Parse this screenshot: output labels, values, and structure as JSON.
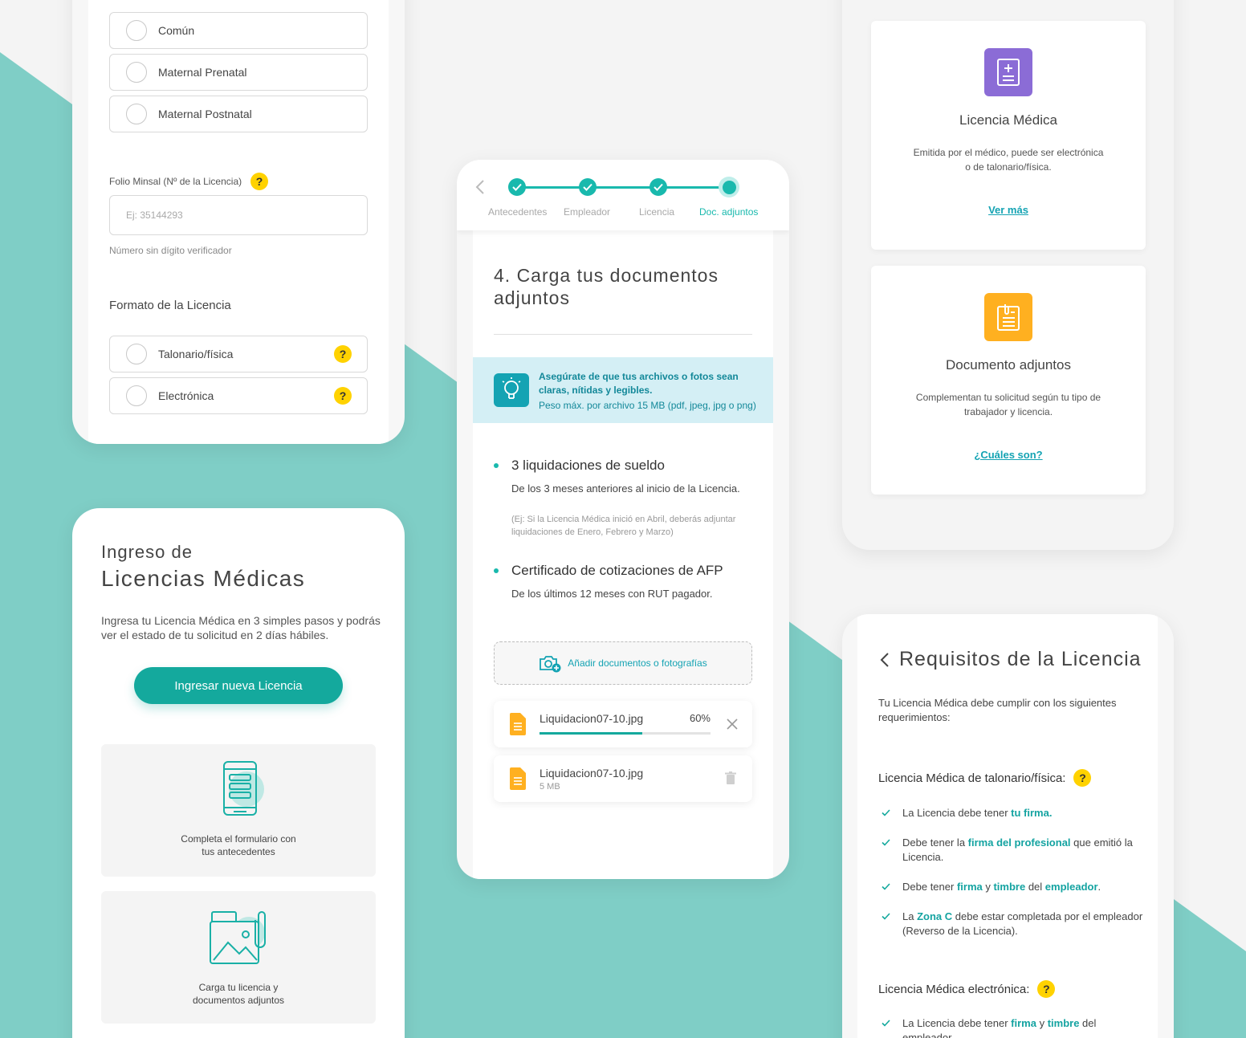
{
  "colors": {
    "teal": "#14a99d",
    "bg_teal": "#7fcec6",
    "purple": "#8b6cd6",
    "orange": "#ffb020",
    "yellow": "#ffd200"
  },
  "form": {
    "license_types": [
      "Común",
      "Maternal Prenatal",
      "Maternal Postnatal"
    ],
    "folio_label": "Folio Minsal (Nº de la Licencia)",
    "folio_placeholder": "Ej: 35144293",
    "folio_hint": "Número sin dígito verificador",
    "format_title": "Formato de la Licencia",
    "format_options": [
      "Talonario/física",
      "Electrónica"
    ],
    "help_icon": "?"
  },
  "landing": {
    "title_small": "Ingreso de",
    "title_big": "Licencias Médicas",
    "description": "Ingresa tu Licencia Médica en 3 simples pasos y podrás ver el estado de tu solicitud en 2 días hábiles.",
    "cta": "Ingresar nueva Licencia",
    "steps": [
      {
        "line1": "Completa el formulario con",
        "line2": "tus antecedentes",
        "icon": "form-phone-icon"
      },
      {
        "line1": "Carga tu licencia y",
        "line2": "documentos adjuntos",
        "icon": "documents-attach-icon"
      }
    ]
  },
  "upload": {
    "stepper": [
      "Antecedentes",
      "Empleador",
      "Licencia",
      "Doc. adjuntos"
    ],
    "title": "4. Carga tus documentos adjuntos",
    "tip_bold": "Asegúrate de que tus archivos o fotos sean claras, nítidas y legibles.",
    "tip_sub": "Peso máx. por archivo 15 MB (pdf, jpeg, jpg o png)",
    "requirements": [
      {
        "title": "3 liquidaciones de sueldo",
        "desc": "De los 3 meses anteriores al inicio de la Licencia.",
        "note": "(Ej: Si la Licencia Médica inició en Abril, deberás adjuntar liquidaciones de Enero, Febrero y Marzo)"
      },
      {
        "title": "Certificado de cotizaciones de AFP",
        "desc": "De los últimos 12 meses con RUT pagador."
      }
    ],
    "add_button": "Añadir documentos o fotografías",
    "files": [
      {
        "name": "Liquidacion07-10.jpg",
        "progress_label": "60%",
        "progress": 0.6
      },
      {
        "name": "Liquidacion07-10.jpg",
        "size": "5 MB"
      }
    ]
  },
  "info": {
    "cards": [
      {
        "title": "Licencia Médica",
        "desc": "Emitida por el médico, puede ser electrónica o de talonario/física.",
        "link": "Ver más",
        "icon": "medical-document-icon"
      },
      {
        "title": "Documento adjuntos",
        "desc": "Complementan tu solicitud según tu tipo de trabajador y licencia.",
        "link": "¿Cuáles son?",
        "icon": "clipboard-icon"
      }
    ]
  },
  "requirements": {
    "title": "Requisitos de la Licencia",
    "intro": "Tu Licencia Médica debe cumplir con los siguientes requerimientos:",
    "section1": "Licencia Médica de talonario/física:",
    "items1": [
      {
        "pre": "La Licencia debe tener ",
        "hl1": "tu firma.",
        "mid": "",
        "hl2": "",
        "mid2": "",
        "hl3": "",
        "post": ""
      },
      {
        "pre": "Debe tener la ",
        "hl1": "firma del profesional",
        "mid": " que emitió la Licencia.",
        "hl2": "",
        "mid2": "",
        "hl3": "",
        "post": ""
      },
      {
        "pre": "Debe tener ",
        "hl1": "firma",
        "mid": " y ",
        "hl2": "timbre",
        "mid2": " del ",
        "hl3": "empleador",
        "post": "."
      },
      {
        "pre": "La ",
        "hl1": "Zona C",
        "mid": " debe estar completada por el empleador (Reverso de la Licencia).",
        "hl2": "",
        "mid2": "",
        "hl3": "",
        "post": ""
      }
    ],
    "section2": "Licencia Médica electrónica:",
    "items2": [
      {
        "pre": "La Licencia debe tener ",
        "hl1": "firma",
        "mid": " y ",
        "hl2": "timbre",
        "mid2": " del empleador.",
        "hl3": "",
        "post": ""
      }
    ]
  }
}
